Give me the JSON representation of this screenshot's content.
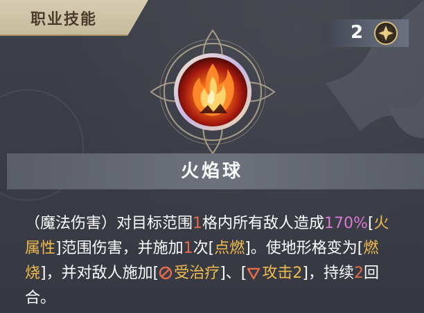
{
  "header": {
    "title": "职业技能"
  },
  "cost": {
    "value": "2",
    "icon": "star-coin-icon"
  },
  "skill": {
    "icon": "fireball-icon",
    "name": "火焰球"
  },
  "description": {
    "p1": "（魔法伤害）对目标范围",
    "n1": "1",
    "p2": "格内所有敌人造成",
    "pct": "170%",
    "b1": "[",
    "kw1": "火属性",
    "p3": "]范围伤害，并施加",
    "n2": "1",
    "p4": "次[",
    "kw2": "点燃",
    "p5": "]。使地形格变为[",
    "kw3": "燃烧",
    "p6": "]，并对敌人施加[",
    "kw4": "受治疗",
    "p7": "]、[",
    "kw5": "攻击2",
    "p8": "]，持续",
    "n3": "2",
    "p9": "回合。"
  },
  "colors": {
    "number": "#e26b4b",
    "percent": "#d97ad3",
    "keyword": "#f0bc4d",
    "header_bg": "#d7ccb1"
  }
}
